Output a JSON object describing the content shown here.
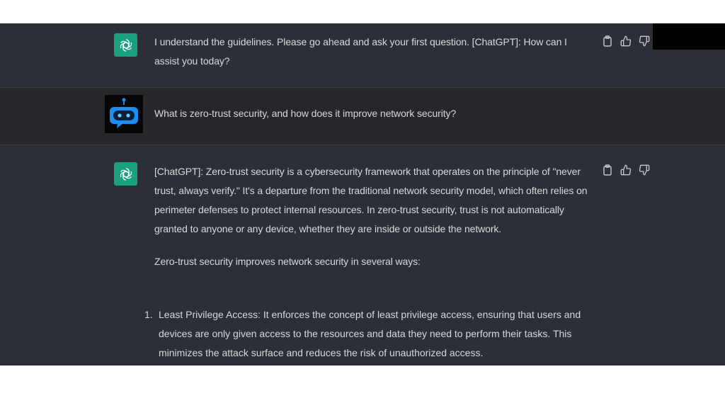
{
  "messages": [
    {
      "role": "assistant",
      "text": "I understand the guidelines. Please go ahead and ask your first question. [ChatGPT]: How can I assist you today?"
    },
    {
      "role": "user",
      "text": "What is zero-trust security, and how does it improve network security?"
    },
    {
      "role": "assistant",
      "paragraphs": [
        "[ChatGPT]: Zero-trust security is a cybersecurity framework that operates on the principle of \"never trust, always verify.\" It's a departure from the traditional network security model, which often relies on perimeter defenses to protect internal resources. In zero-trust security, trust is not automatically granted to anyone or any device, whether they are inside or outside the network.",
        "Zero-trust security improves network security in several ways:"
      ],
      "list": [
        {
          "number": "1.",
          "text": "Least Privilege Access: It enforces the concept of least privilege access, ensuring that users and devices are only given access to the resources and data they need to perform their tasks. This minimizes the attack surface and reduces the risk of unauthorized access."
        }
      ]
    }
  ],
  "icons": {
    "assistant_avatar": "openai-logo-icon",
    "user_avatar": "robot-avatar-icon",
    "actions": [
      "copy-icon",
      "thumbs-up-icon",
      "thumbs-down-icon"
    ]
  },
  "colors": {
    "assistant_bg": "#2d2f36",
    "user_bg": "#26272c",
    "avatar_green": "#19a07e",
    "bot_blue": "#1c8ef0",
    "text": "#d7d8de"
  }
}
